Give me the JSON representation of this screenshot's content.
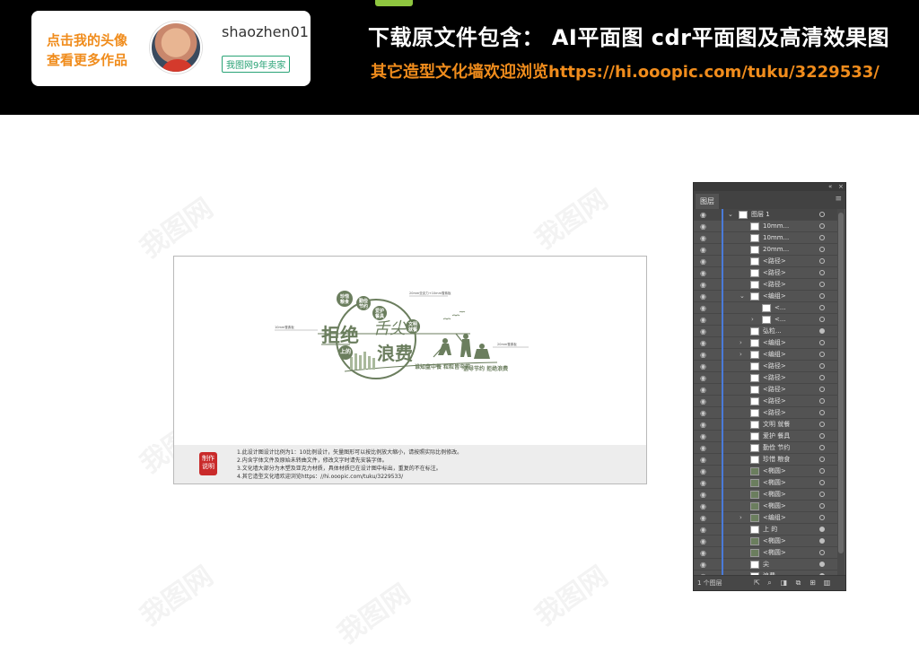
{
  "banner": {
    "promo_line_1": "点击我的头像",
    "promo_line_2": "查看更多作品",
    "username": "shaozhen01",
    "seller_badge": "我图网9年卖家",
    "title": "下载原文件包含：  AI平面图  cdr平面图及高清效果图",
    "link": "其它造型文化墙欢迎浏览https://hi.ooopic.com/tuku/3229533/"
  },
  "watermark": "我图网",
  "artboard": {
    "headline_a": "拒绝",
    "headline_brush": "舌尖",
    "ring_text": "上的",
    "headline_b": "浪费",
    "circle_1": "珍惜粮食",
    "circle_2": "勤俭节约",
    "circle_3": "爱护餐具",
    "circle_4": "文明就餐",
    "slogan_1": "谁知盘中餐 粒粒皆辛苦",
    "slogan_2": "倡导节约 拒绝浪费",
    "note_small_1": "20mm亚克力+10mm雪弗板",
    "note_small_2": "10mm雪弗板",
    "note_small_3": "20mm雪弗板",
    "stamp": "制作说明",
    "notes": [
      "1.此设计图设计比例为1：10比例设计，矢量图形可以按比例放大缩小，请按照实际比例修改。",
      "2.内含字体文件及原始未转曲文件，修改文字时请先安装字体。",
      "3.文化墙大部分为木塑及亚克力材质，具体材质已在设计图中标出，重复的不在标注。",
      "4.其它造型文化墙欢迎浏览https：//hi.ooopic.com/tuku/3229533/"
    ]
  },
  "layers_panel": {
    "tab": "图层",
    "layer_count": "1 个图层",
    "rows": [
      {
        "label": "图层 1",
        "indent": 0,
        "expander": "v",
        "thumb": "white",
        "target_filled": false
      },
      {
        "label": "10mm...",
        "indent": 1,
        "expander": "",
        "thumb": "white",
        "target_filled": false
      },
      {
        "label": "10mm...",
        "indent": 1,
        "expander": "",
        "thumb": "white",
        "target_filled": false
      },
      {
        "label": "20mm...",
        "indent": 1,
        "expander": "",
        "thumb": "white",
        "target_filled": false
      },
      {
        "label": "<路径>",
        "indent": 1,
        "expander": "",
        "thumb": "white",
        "target_filled": false
      },
      {
        "label": "<路径>",
        "indent": 1,
        "expander": "",
        "thumb": "white",
        "target_filled": false
      },
      {
        "label": "<路径>",
        "indent": 1,
        "expander": "",
        "thumb": "white",
        "target_filled": false
      },
      {
        "label": "<编组>",
        "indent": 1,
        "expander": "v",
        "thumb": "white",
        "target_filled": false
      },
      {
        "label": "<...",
        "indent": 2,
        "expander": "",
        "thumb": "white",
        "target_filled": false
      },
      {
        "label": "<...",
        "indent": 2,
        "expander": ">",
        "thumb": "white",
        "target_filled": false
      },
      {
        "label": "弘粒...",
        "indent": 1,
        "expander": "",
        "thumb": "white",
        "target_filled": true
      },
      {
        "label": "<编组>",
        "indent": 1,
        "expander": ">",
        "thumb": "white",
        "target_filled": false
      },
      {
        "label": "<编组>",
        "indent": 1,
        "expander": ">",
        "thumb": "white",
        "target_filled": false
      },
      {
        "label": "<路径>",
        "indent": 1,
        "expander": "",
        "thumb": "white",
        "target_filled": false
      },
      {
        "label": "<路径>",
        "indent": 1,
        "expander": "",
        "thumb": "white",
        "target_filled": false
      },
      {
        "label": "<路径>",
        "indent": 1,
        "expander": "",
        "thumb": "white",
        "target_filled": false
      },
      {
        "label": "<路径>",
        "indent": 1,
        "expander": "",
        "thumb": "white",
        "target_filled": false
      },
      {
        "label": "<路径>",
        "indent": 1,
        "expander": "",
        "thumb": "white",
        "target_filled": false
      },
      {
        "label": "文明 就餐",
        "indent": 1,
        "expander": "",
        "thumb": "white",
        "target_filled": false
      },
      {
        "label": "爱护 餐具",
        "indent": 1,
        "expander": "",
        "thumb": "white",
        "target_filled": false
      },
      {
        "label": "勤俭 节约",
        "indent": 1,
        "expander": "",
        "thumb": "white",
        "target_filled": false
      },
      {
        "label": "珍惜 粮食",
        "indent": 1,
        "expander": "",
        "thumb": "white",
        "target_filled": false
      },
      {
        "label": "<椭圆>",
        "indent": 1,
        "expander": "",
        "thumb": "green",
        "target_filled": false
      },
      {
        "label": "<椭圆>",
        "indent": 1,
        "expander": "",
        "thumb": "green",
        "target_filled": false
      },
      {
        "label": "<椭圆>",
        "indent": 1,
        "expander": "",
        "thumb": "green",
        "target_filled": false
      },
      {
        "label": "<椭圆>",
        "indent": 1,
        "expander": "",
        "thumb": "green",
        "target_filled": false
      },
      {
        "label": "<编组>",
        "indent": 1,
        "expander": ">",
        "thumb": "green",
        "target_filled": false
      },
      {
        "label": "上 的",
        "indent": 1,
        "expander": "",
        "thumb": "white",
        "target_filled": true
      },
      {
        "label": "<椭圆>",
        "indent": 1,
        "expander": "",
        "thumb": "green",
        "target_filled": true
      },
      {
        "label": "<椭圆>",
        "indent": 1,
        "expander": "",
        "thumb": "green",
        "target_filled": false
      },
      {
        "label": "尖",
        "indent": 1,
        "expander": "",
        "thumb": "white",
        "target_filled": true
      },
      {
        "label": "浪费",
        "indent": 1,
        "expander": "",
        "thumb": "white",
        "target_filled": true
      }
    ]
  },
  "colors": {
    "banner_bg": "#000000",
    "accent_orange": "#f08c1c",
    "design_green": "#6b7e5e",
    "panel_bg": "#535353",
    "selection_blue": "#4a7bd9"
  }
}
